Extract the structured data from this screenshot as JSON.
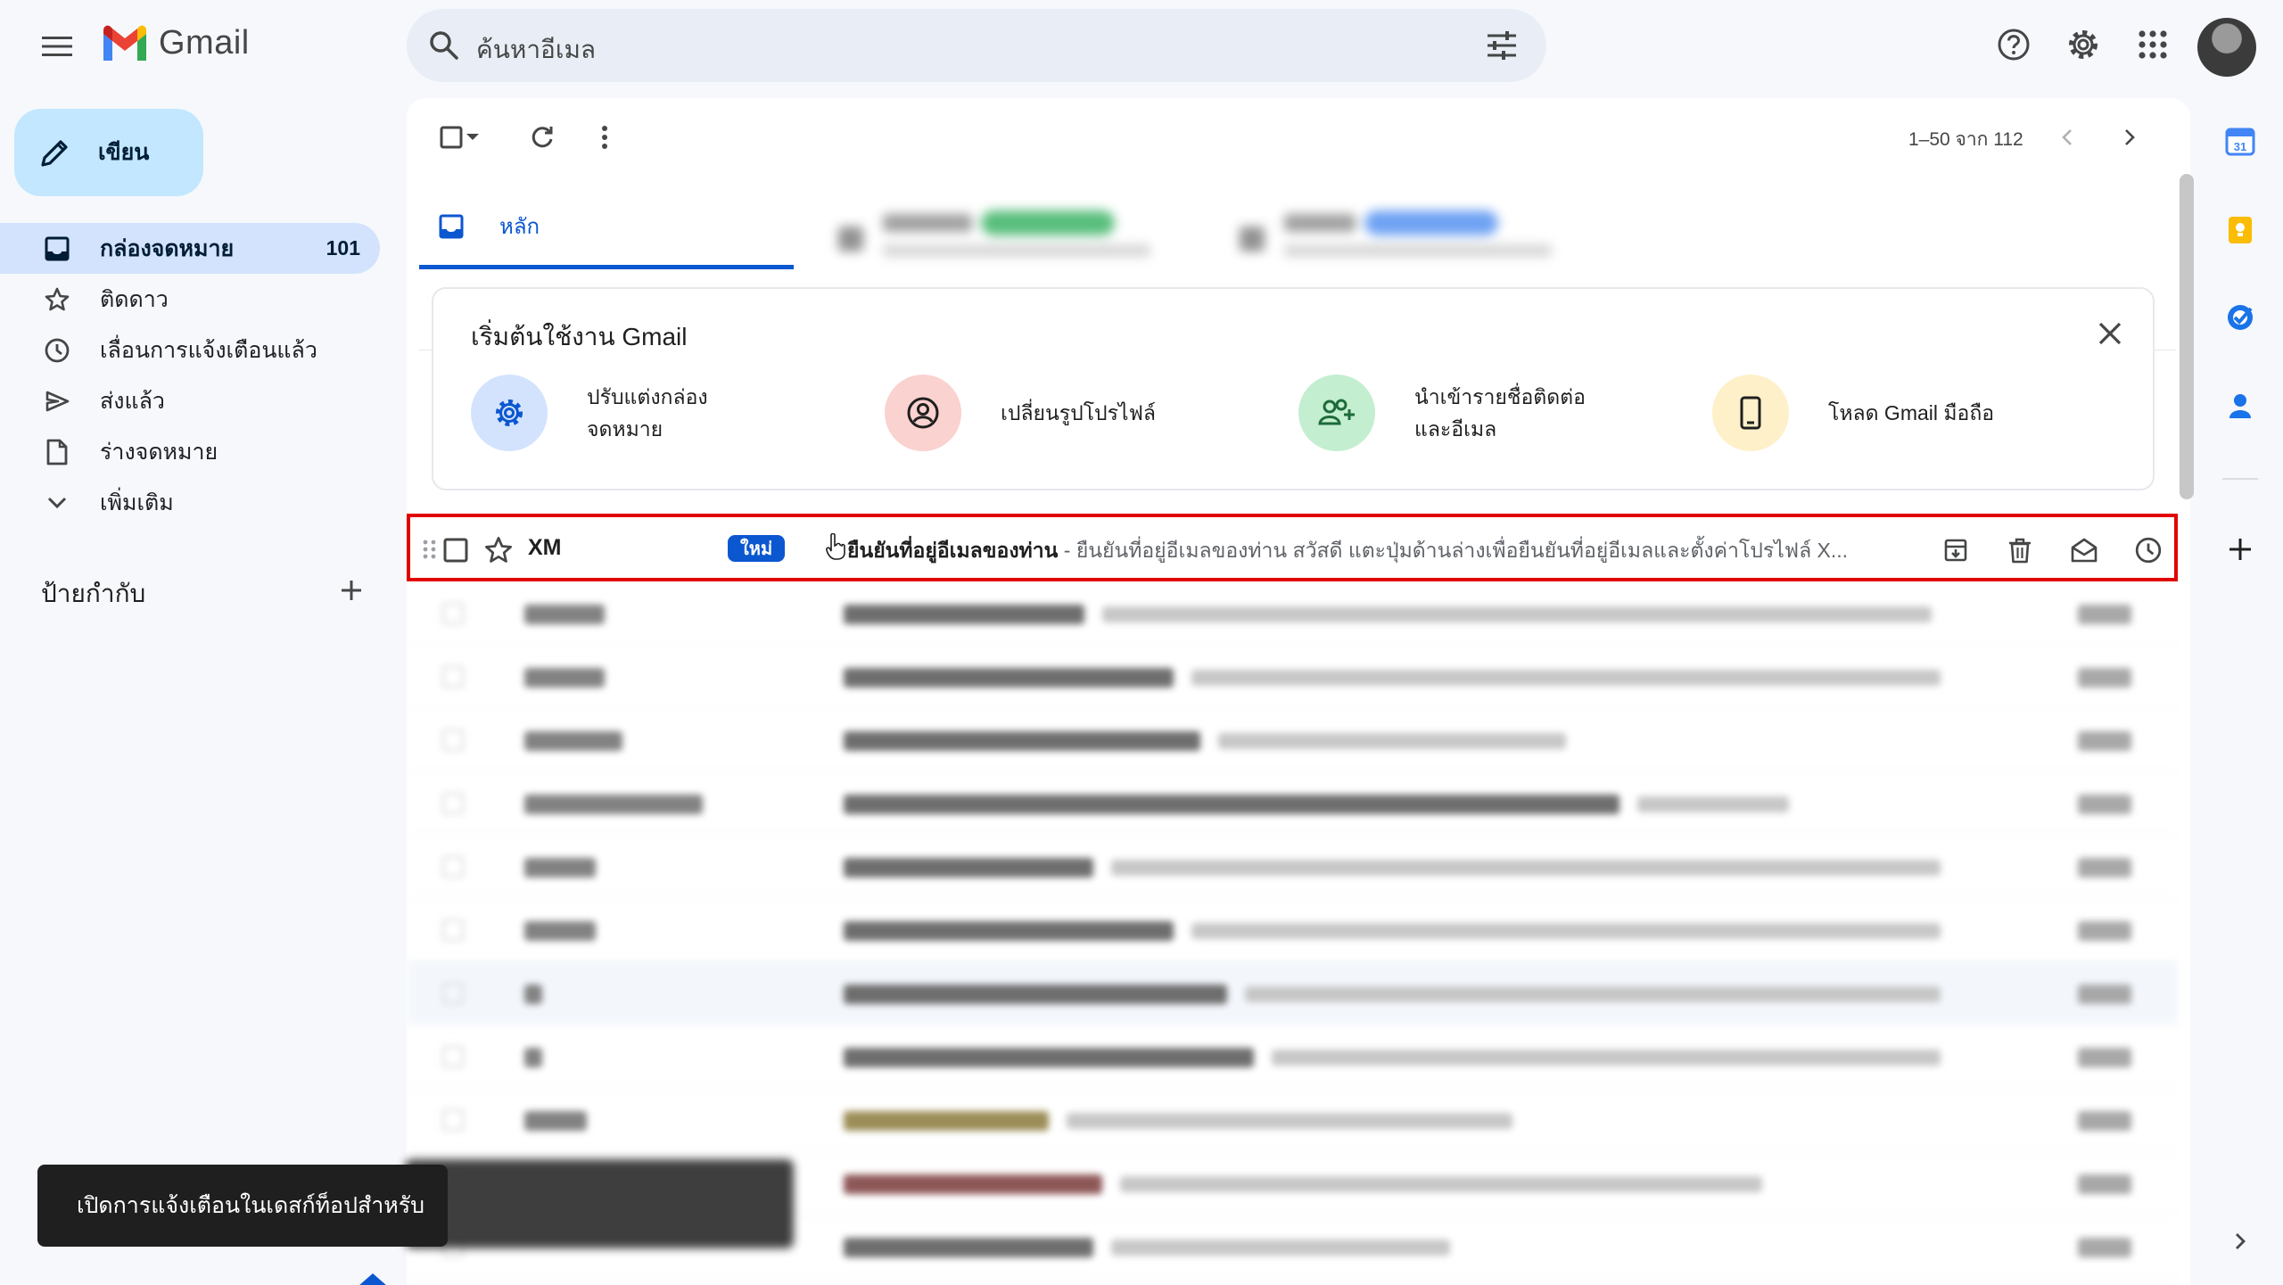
{
  "app": {
    "name": "Gmail",
    "accent": "#0b57d0",
    "highlight_color": "#e10000"
  },
  "search": {
    "placeholder": "ค้นหาอีเมล"
  },
  "compose": {
    "label": "เขียน"
  },
  "sidebar": {
    "items": [
      {
        "label": "กล่องจดหมาย",
        "count": "101",
        "icon": "inbox-icon",
        "active": true
      },
      {
        "label": "ติดดาว",
        "icon": "star-icon"
      },
      {
        "label": "เลื่อนการแจ้งเตือนแล้ว",
        "icon": "clock-icon"
      },
      {
        "label": "ส่งแล้ว",
        "icon": "send-icon"
      },
      {
        "label": "ร่างจดหมาย",
        "icon": "draft-icon"
      },
      {
        "label": "เพิ่มเติม",
        "icon": "chevron-down-icon"
      }
    ],
    "labels_header": "ป้ายกำกับ"
  },
  "toolbar": {
    "pager": "1–50 จาก 112"
  },
  "tabs": {
    "main_label": "หลัก"
  },
  "onboarding": {
    "title": "เริ่มต้นใช้งาน Gmail",
    "items": [
      {
        "label": "ปรับแต่งกล่อง\nจดหมาย",
        "icon": "gear-icon",
        "color": "#d3e3fd"
      },
      {
        "label": "เปลี่ยนรูปโปรไฟล์",
        "icon": "profile-icon",
        "color": "#fad2cf"
      },
      {
        "label": "นำเข้ารายชื่อติดต่อ\nและอีเมล",
        "icon": "add-contact-icon",
        "color": "#c4eed0"
      },
      {
        "label": "โหลด Gmail มือถือ",
        "icon": "mobile-icon",
        "color": "#fef0c9"
      }
    ]
  },
  "email": {
    "sender": "XM",
    "badge": "ใหม่",
    "subject": "ยืนยันที่อยู่อีเมลของท่าน",
    "separator": " - ",
    "snippet": "ยืนยันที่อยู่อีเมลของท่าน สวัสดี แตะปุ่มด้านล่างเพื่อยืนยันที่อยู่อีเมลและตั้งค่าโปรไฟล์ X..."
  },
  "snackbar": {
    "text": "เปิดการแจ้งเตือนในเดสก์ท็อปสำหรับ"
  }
}
